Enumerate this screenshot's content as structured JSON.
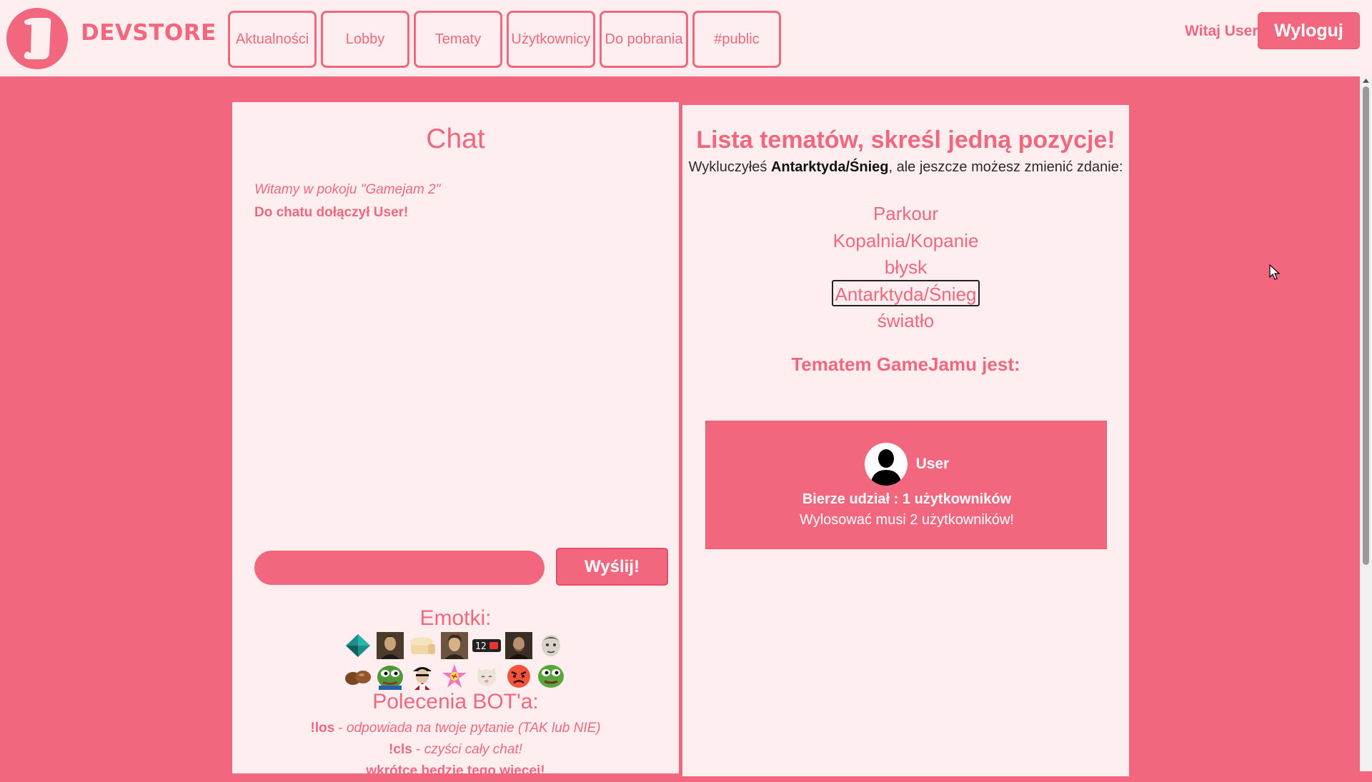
{
  "header": {
    "brand": "DEVSTORE",
    "nav": [
      "Aktualności",
      "Lobby",
      "Tematy",
      "Użytkownicy",
      "Do pobrania",
      "#public"
    ],
    "greeting": "Witaj User!",
    "logout": "Wyloguj"
  },
  "chat": {
    "title": "Chat",
    "welcome": "Witamy w pokoju \"Gamejam 2\"",
    "join_message": "Do chatu dołączył User!",
    "input_value": "",
    "send_label": "Wyślij!",
    "emotes_title": "Emotki:",
    "bot_title": "Polecenia BOT'a:",
    "bot_commands": [
      {
        "cmd": "!los",
        "sep": " - ",
        "desc": "odpowiada na twoje pytanie (TAK lub NIE)"
      },
      {
        "cmd": "!cls",
        "sep": " - ",
        "desc": "czyści cały chat!"
      }
    ],
    "bot_footer": "wkrótce bedzie tego wiecej!"
  },
  "topics": {
    "title": "Lista tematów, skreśl jedną pozycje!",
    "excluded_prefix": "Wykluczyłeś ",
    "excluded_topic": "Antarktyda/Śnieg",
    "excluded_suffix": ", ale jeszcze możesz zmienić zdanie:",
    "items": [
      "Parkour",
      "Kopalnia/Kopanie",
      "błysk",
      "Antarktyda/Śnieg",
      "światło"
    ],
    "selected_index": 3,
    "theme_label": "Tematem GameJamu jest:"
  },
  "participants": {
    "user_name": "User",
    "count_text": "Bierze udział : 1 użytkowników",
    "need_text": "Wylosować musi 2 użytkowników!"
  },
  "colors": {
    "accent": "#f3677e",
    "panel": "#ffeef0",
    "text_dark": "#2b2b2b"
  },
  "emotes": [
    "teal-diamond-emote",
    "portrait-emote-1",
    "bread-emote",
    "portrait-emote-2",
    "score-12-emote",
    "portrait-emote-3",
    "face-emote-1",
    "chestnut-emote",
    "pepe-emote-1",
    "pirate-emote",
    "pink-star-emote",
    "cat-emote",
    "angry-face-emote",
    "pepe-emote-2"
  ]
}
